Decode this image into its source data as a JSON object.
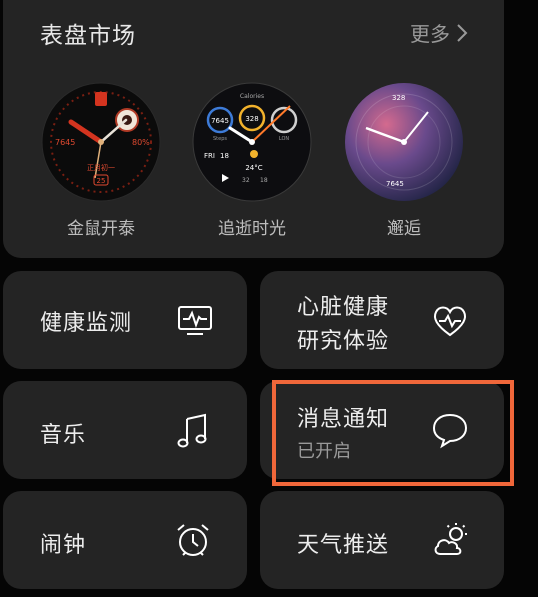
{
  "market": {
    "title": "表盘市场",
    "more_label": "更多"
  },
  "watchfaces": [
    {
      "label": "金鼠开泰",
      "steps": "7645",
      "battery": "80%",
      "date_text": "正月初一",
      "day": "25"
    },
    {
      "label": "追逝时光",
      "top_label": "Calories",
      "left_value": "7645",
      "left_caption": "Steps",
      "center_value": "328",
      "right_caption": "LON",
      "date_text": "FRI",
      "date_num": "18",
      "temp": "24°C",
      "sub1": "32",
      "sub2": "18"
    },
    {
      "label": "邂逅",
      "top_value": "328",
      "bottom_value": "7645"
    }
  ],
  "tiles": {
    "health": {
      "label": "健康监测"
    },
    "heart": {
      "label_line1": "心脏健康",
      "label_line2": "研究体验"
    },
    "music": {
      "label": "音乐"
    },
    "notify": {
      "label": "消息通知",
      "status": "已开启"
    },
    "alarm": {
      "label": "闹钟"
    },
    "weather": {
      "label": "天气推送"
    }
  },
  "colors": {
    "card_bg": "#242424",
    "page_bg": "#050505",
    "highlight": "#f0673a"
  }
}
